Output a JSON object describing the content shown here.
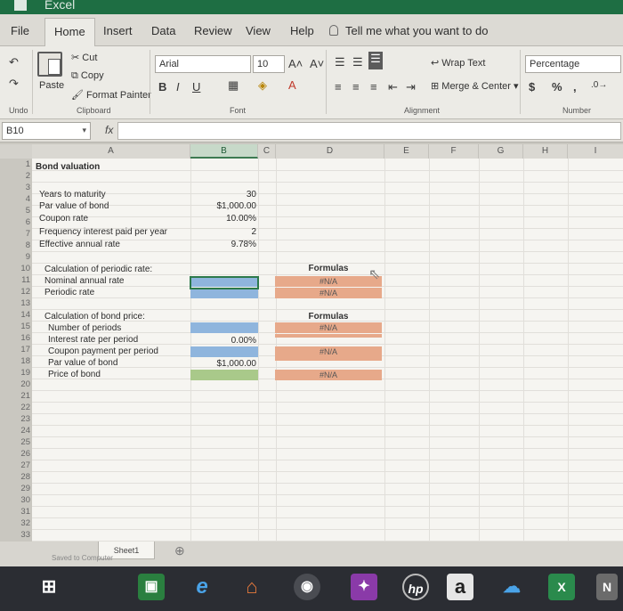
{
  "window": {
    "title": "Excel"
  },
  "tabs": [
    "File",
    "Home",
    "Insert",
    "Data",
    "Review",
    "View",
    "Help"
  ],
  "tell_me": "Tell me what you want to do",
  "ribbon": {
    "undo_label": "Undo",
    "clipboard": {
      "cut": "Cut",
      "copy": "Copy",
      "paste": "Paste",
      "format_painter": "Format Painter",
      "group_label": "Clipboard"
    },
    "font": {
      "name": "Arial",
      "size": "10",
      "group_label": "Font",
      "bold": "B",
      "italic": "I",
      "underline": "U"
    },
    "alignment": {
      "wrap_text": "Wrap Text",
      "merge_center": "Merge & Center",
      "group_label": "Alignment"
    },
    "number": {
      "format": "Percentage",
      "currency": "$",
      "percent": "%",
      "comma": ",",
      "group_label": "Number"
    }
  },
  "formula_bar": {
    "name_box": "B10",
    "fx": "fx",
    "value": ""
  },
  "columns": [
    "A",
    "B",
    "C",
    "D",
    "E",
    "F",
    "G",
    "H",
    "I"
  ],
  "rows": [
    "1",
    "2",
    "3",
    "4",
    "5",
    "6",
    "7",
    "8",
    "9",
    "10",
    "11",
    "12",
    "13",
    "14",
    "15",
    "16",
    "17",
    "18",
    "19",
    "20",
    "21",
    "22",
    "23",
    "24",
    "25",
    "26",
    "27",
    "28",
    "29",
    "30",
    "31",
    "32",
    "33"
  ],
  "sheet": {
    "a1": "Bond valuation",
    "a3": "Years to maturity",
    "a4": "Par value of bond",
    "a5": "Coupon rate",
    "a6": "Frequency interest paid per year",
    "a7": "Effective annual rate",
    "b3": "30",
    "b4": "$1,000.00",
    "b5": "10.00%",
    "b6": "2",
    "b7": "9.78%",
    "a9": "Calculation of periodic rate:",
    "a10": "Nominal annual rate",
    "a11": "Periodic rate",
    "d9": "Formulas",
    "d10": "#N/A",
    "d11": "#N/A",
    "a13": "Calculation of bond price:",
    "a14": "Number of periods",
    "a15": "Interest rate per period",
    "a16": "Coupon payment per period",
    "a17": "Par value of bond",
    "a18": "Price of bond",
    "b15": "0.00%",
    "b17": "$1,000.00",
    "d13": "Formulas",
    "d14": "#N/A",
    "d16": "#N/A",
    "d18": "#N/A"
  },
  "sheet_tab": "Sheet1",
  "status": "Saved to Computer",
  "taskbar": [
    "windows-logo",
    "store",
    "edge",
    "home",
    "media",
    "app",
    "hp",
    "amazon",
    "cloud",
    "excel",
    "onenote"
  ]
}
